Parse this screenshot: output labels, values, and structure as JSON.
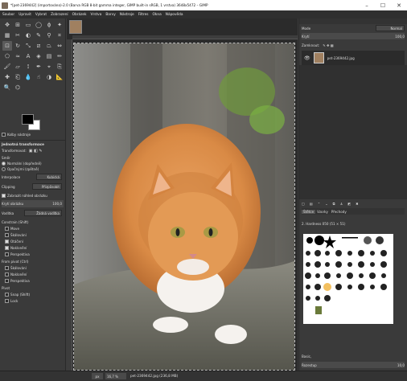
{
  "window": {
    "title": "*[pet-2369442] (importováno)-2.0 (Barva RGB 8-bit gamma integer, GIMP built-in sRGB, 1 vrstva) 3648x5472 – GIMP",
    "minimize": "–",
    "maximize": "☐",
    "close": "✕"
  },
  "menu": [
    "Soubor",
    "Upravit",
    "Vybrat",
    "Zobrazení",
    "Obrázek",
    "Vrstva",
    "Barvy",
    "Nástroje",
    "Filtres",
    "Okna",
    "Nápověda"
  ],
  "toolbox": {
    "tools": [
      "move-icon",
      "align-icon",
      "rect-select-icon",
      "ellipse-select-icon",
      "lasso-icon",
      "fuzzy-select-icon",
      "color-select-icon",
      "scissors-icon",
      "foreground-select-icon",
      "paths-icon",
      "color-picker-icon",
      "crop-icon",
      "unified-transform-icon",
      "rotate-icon",
      "scale-icon",
      "shear-icon",
      "perspective-icon",
      "flip-icon",
      "cage-icon",
      "warp-icon",
      "text-icon",
      "bucket-fill-icon",
      "gradient-icon",
      "pencil-icon",
      "paintbrush-icon",
      "eraser-icon",
      "airbrush-icon",
      "ink-icon",
      "mypaint-icon",
      "clone-icon",
      "heal-icon",
      "perspective-clone-icon",
      "blur-icon",
      "smudge-icon",
      "dodge-icon",
      "measure-icon",
      "zoom-icon",
      "handle-transform-icon"
    ],
    "tool_options_title": "Jednotná transformace",
    "transform_label": "Transformovat:",
    "direction_label": "Směr",
    "direction_options": [
      "Normální (dopředně)",
      "Opačnými (zpětně)"
    ],
    "interpolation_label": "Interpolace",
    "interpolation_value": "Kubická",
    "clipping_label": "Clipping",
    "clipping_value": "Přizpůsobit",
    "show_preview": "Zobrazit náhled obrázku",
    "opacity_label": "Krytí obrázku",
    "opacity_value": "100,0",
    "guides_label": "Vodítka",
    "guides_value": "Žádná vodítka",
    "constrain_label": "Constrain (Shift)",
    "constrain_items": [
      {
        "label": "Move",
        "on": false
      },
      {
        "label": "Škálování",
        "on": false
      },
      {
        "label": "Otáčení",
        "on": true
      },
      {
        "label": "Naklonění",
        "on": true
      },
      {
        "label": "Perspektiva",
        "on": false
      }
    ],
    "from_pivot_label": "From pivot (Ctrl)",
    "from_pivot_items": [
      {
        "label": "Škálování",
        "on": false
      },
      {
        "label": "Naklonění",
        "on": false
      },
      {
        "label": "Perspektiva",
        "on": false
      }
    ],
    "pivot_label": "Pivot",
    "pivot_items": [
      {
        "label": "Snap (Shift)",
        "on": false
      },
      {
        "label": "Lock",
        "on": false
      }
    ],
    "fill_label": "Kolby nástroje"
  },
  "right_dock": {
    "mode_label": "Mode",
    "mode_value": "Normal",
    "opacity_label": "Krytí",
    "opacity_value": "100,0",
    "lock_label": "Zamknout:",
    "layer_name": "pet-2369442.jpg",
    "tabs": [
      "Štětce",
      "Vzorky",
      "Přechody"
    ],
    "brush_title": "2. Hardness 050 (51 × 51)",
    "brush_tag": "Basic,",
    "spacing_label": "Rozestup",
    "spacing_value": "10,0"
  },
  "status": {
    "unit": "px",
    "zoom": "16,7 %",
    "file": "pet-2369442.jpg (236,8 MB)"
  },
  "colors": {
    "fg": "#000000",
    "bg": "#ffffff",
    "accent": "#5a5a5a"
  }
}
